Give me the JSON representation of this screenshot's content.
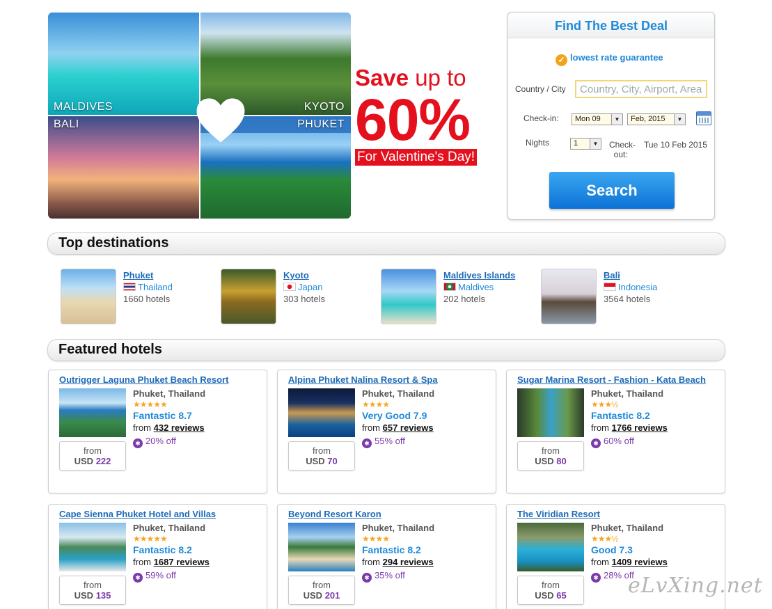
{
  "banner": {
    "tiles": [
      {
        "caption": "MALDIVES"
      },
      {
        "caption": "KYOTO"
      },
      {
        "caption": "BALI"
      },
      {
        "caption": "PHUKET"
      }
    ],
    "promo_save": "Save",
    "promo_upto": "up to",
    "promo_percent": "60%",
    "promo_ribbon": "For Valentine's Day!"
  },
  "deal_box": {
    "title": "Find The Best Deal",
    "guarantee": "lowest rate guarantee",
    "country_label": "Country / City",
    "country_placeholder": "Country, City, Airport, Area",
    "checkin_label": "Check-in:",
    "checkin_day": "Mon 09",
    "checkin_month": "Feb, 2015",
    "nights_label": "Nights",
    "nights_value": "1",
    "checkout_label_1": "Check-",
    "checkout_label_2": "out:",
    "checkout_value": "Tue 10 Feb 2015",
    "search_label": "Search"
  },
  "top_destinations": {
    "title": "Top destinations",
    "items": [
      {
        "name": "Phuket",
        "country": "Thailand",
        "count": "1660 hotels"
      },
      {
        "name": "Kyoto",
        "country": "Japan",
        "count": "303 hotels"
      },
      {
        "name": "Maldives Islands",
        "country": "Maldives",
        "count": "202 hotels"
      },
      {
        "name": "Bali",
        "country": "Indonesia",
        "count": "3564 hotels"
      }
    ]
  },
  "featured_hotels": {
    "title": "Featured hotels",
    "from_label": "from",
    "from_prefix": "from",
    "items": [
      {
        "name": "Outrigger Laguna Phuket Beach Resort",
        "location": "Phuket, Thailand",
        "stars": "★★★★★",
        "rating": "Fantastic 8.7",
        "reviews": "432 reviews",
        "discount": "20% off",
        "currency": "USD",
        "price": "222"
      },
      {
        "name": "Alpina Phuket Nalina Resort & Spa",
        "location": "Phuket, Thailand",
        "stars": "★★★★",
        "rating": "Very Good 7.9",
        "reviews": "657 reviews",
        "discount": "55% off",
        "currency": "USD",
        "price": "70"
      },
      {
        "name": "Sugar Marina Resort - Fashion - Kata Beach",
        "location": "Phuket, Thailand",
        "stars": "★★★½",
        "rating": "Fantastic 8.2",
        "reviews": "1766 reviews",
        "discount": "60% off",
        "currency": "USD",
        "price": "80"
      },
      {
        "name": "Cape Sienna Phuket Hotel and Villas",
        "location": "Phuket, Thailand",
        "stars": "★★★★★",
        "rating": "Fantastic 8.2",
        "reviews": "1687 reviews",
        "discount": "59% off",
        "currency": "USD",
        "price": "135"
      },
      {
        "name": "Beyond Resort Karon",
        "location": "Phuket, Thailand",
        "stars": "★★★★",
        "rating": "Fantastic 8.2",
        "reviews": "294 reviews",
        "discount": "35% off",
        "currency": "USD",
        "price": "201"
      },
      {
        "name": "The Viridian Resort",
        "location": "Phuket, Thailand",
        "stars": "★★★½",
        "rating": "Good 7.3",
        "reviews": "1409 reviews",
        "discount": "28% off",
        "currency": "USD",
        "price": "65"
      }
    ]
  },
  "watermark": "eLvXing.net",
  "colors": {
    "accent": "#1e8ad8",
    "promo_red": "#e4101e",
    "discount_purple": "#7a3aaa",
    "star": "#f5a623"
  }
}
